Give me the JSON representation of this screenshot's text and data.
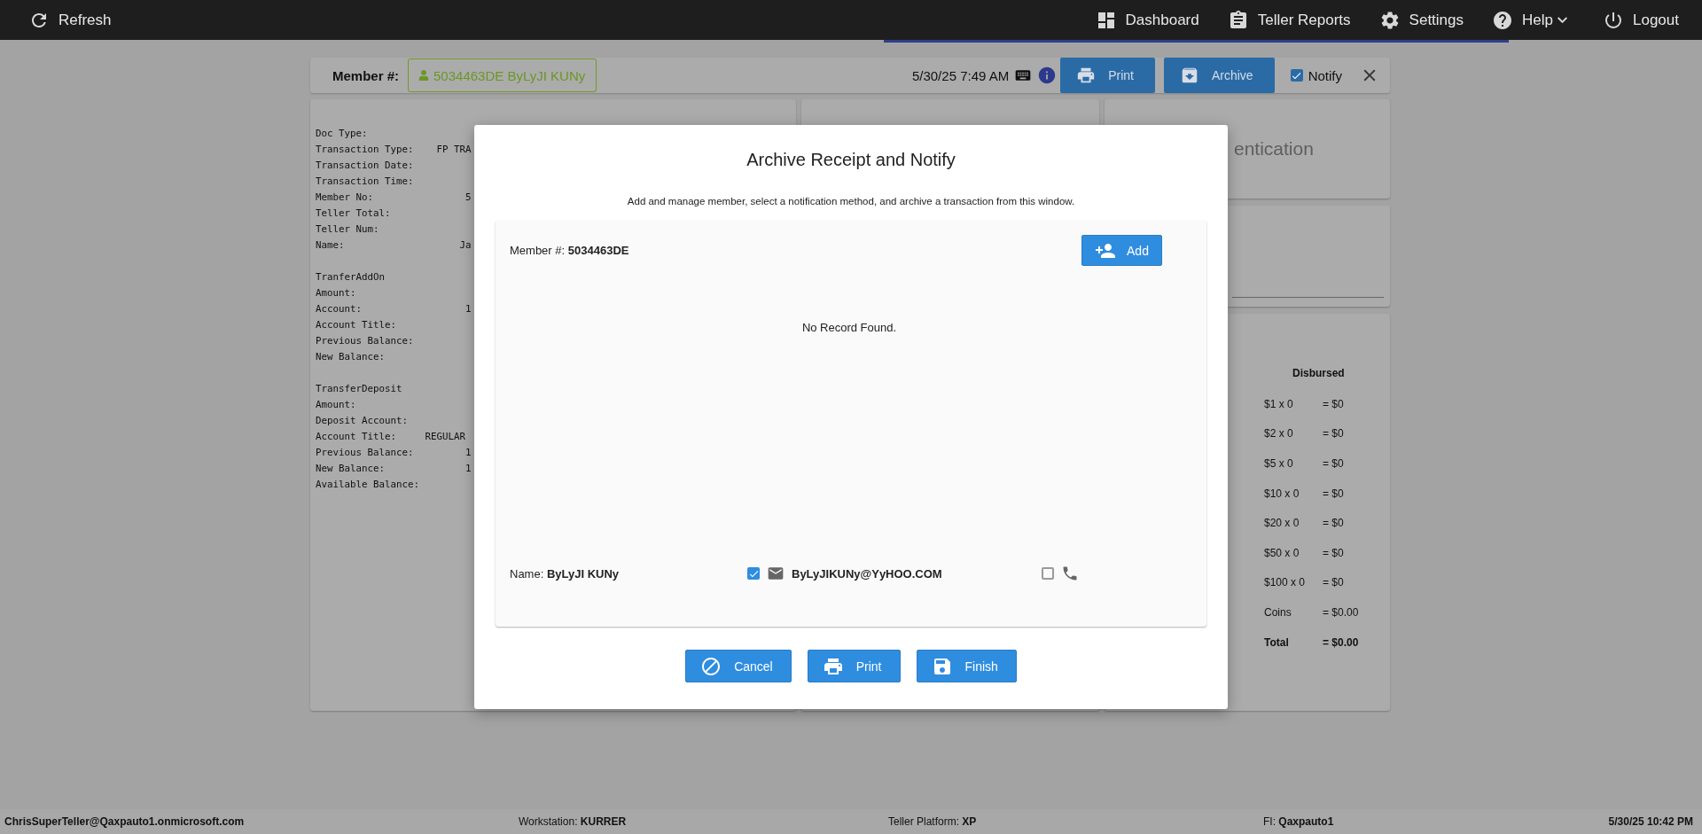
{
  "topbar": {
    "refresh": "Refresh",
    "nav": [
      {
        "label": "Dashboard",
        "kind": "dashboard"
      },
      {
        "label": "Teller Reports",
        "kind": "reports"
      },
      {
        "label": "Settings",
        "kind": "settings"
      },
      {
        "label": "Help",
        "kind": "help",
        "has_menu": true
      },
      {
        "label": "Logout",
        "kind": "logout"
      }
    ]
  },
  "member_bar": {
    "label": "Member #:",
    "member": "5034463DE ByLyJI KUNy",
    "datetime": "5/30/25 7:49 AM",
    "print": "Print",
    "archive": "Archive",
    "notify": {
      "label": "Notify",
      "checked": true
    }
  },
  "receipt": {
    "sections": [
      [
        "Doc Type:",
        "Transaction Type:    FP TRA",
        "Transaction Date:",
        "Transaction Time:",
        "Member No:                5",
        "Teller Total:",
        "Teller Num:",
        "Name:                    Ja"
      ],
      [
        "TranferAddOn",
        "Amount:",
        "Account:                  1",
        "Account Title:",
        "Previous Balance:",
        "New Balance:"
      ],
      [
        "TransferDeposit",
        "Amount:",
        "Deposit Account:",
        "Account Title:     REGULAR",
        "Previous Balance:         1",
        "New Balance:              1",
        "Available Balance:"
      ]
    ]
  },
  "auth_card": {
    "title": "entication"
  },
  "cash": {
    "heading": "Disbursed",
    "rows": [
      {
        "denomination": "$1 x 0",
        "amount": "= $0",
        "total": false
      },
      {
        "denomination": "$2 x 0",
        "amount": "= $0",
        "total": false
      },
      {
        "denomination": "$5 x 0",
        "amount": "= $0",
        "total": false
      },
      {
        "denomination": "$10 x 0",
        "amount": "= $0",
        "total": false
      },
      {
        "denomination": "$20 x 0",
        "amount": "= $0",
        "total": false
      },
      {
        "denomination": "$50 x 0",
        "amount": "= $0",
        "total": false
      },
      {
        "denomination": "$100 x 0",
        "amount": "= $0",
        "total": false
      },
      {
        "denomination": "Coins",
        "amount": "= $0.00",
        "total": false
      },
      {
        "denomination": "Total",
        "amount": "= $0.00",
        "total": true
      }
    ]
  },
  "dialog": {
    "title": "Archive Receipt and Notify",
    "subtitle": "Add and manage member, select a notification method, and archive a transaction from this window.",
    "member_label": "Member #:",
    "member_number": "5034463DE",
    "add": "Add",
    "empty": "No Record Found.",
    "name_label": "Name:",
    "name": "ByLyJI KUNy",
    "email": {
      "checked": true,
      "address": "ByLyJIKUNy@YyHOO.COM"
    },
    "phone": {
      "checked": false
    },
    "buttons": [
      {
        "label": "Cancel",
        "kind": "cancel"
      },
      {
        "label": "Print",
        "kind": "print"
      },
      {
        "label": "Finish",
        "kind": "finish"
      }
    ]
  },
  "status_bar": [
    {
      "value": "ChrisSuperTeller@Qaxpauto1.onmicrosoft.com"
    },
    {
      "label": "Workstation:",
      "value": "KURRER"
    },
    {
      "label": "Teller Platform:",
      "value": "XP"
    },
    {
      "label": "FI:",
      "value": "Qaxpauto1"
    },
    {
      "value": "5/30/25 10:42 PM"
    }
  ]
}
